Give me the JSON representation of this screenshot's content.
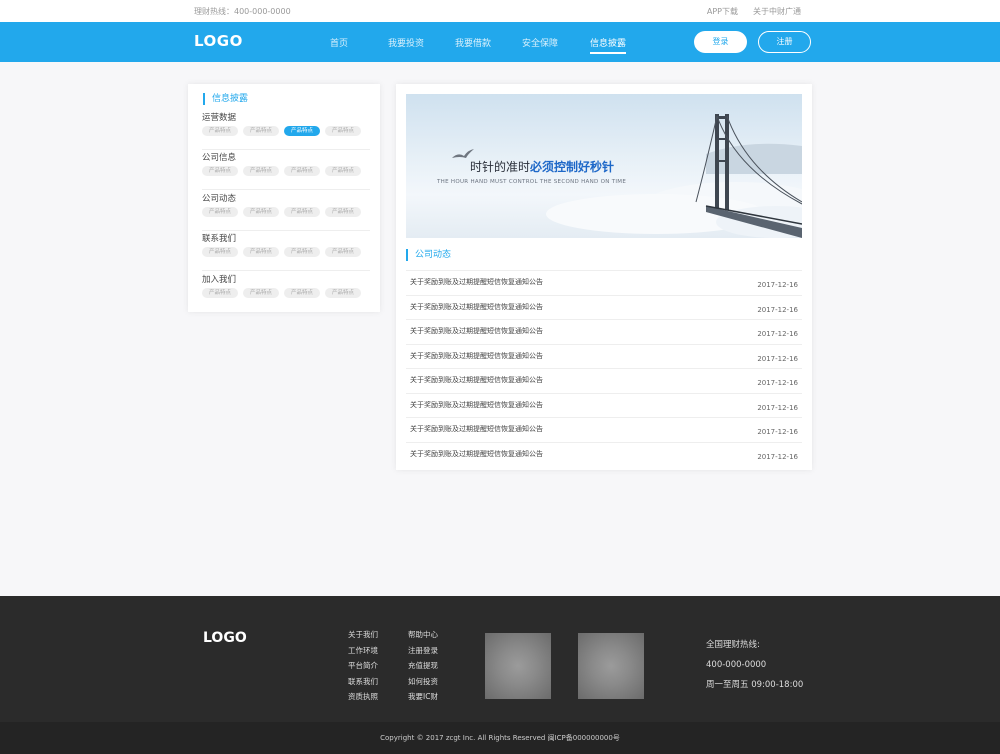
{
  "topbar": {
    "hotline": "理财热线：400-000-0000",
    "app_download": "APP下载",
    "about_broadcast": "关于中财广通"
  },
  "nav": {
    "logo": "LOGO",
    "items": [
      {
        "label": "首页"
      },
      {
        "label": "我要投资"
      },
      {
        "label": "我要借款"
      },
      {
        "label": "安全保障"
      },
      {
        "label": "信息披露"
      }
    ],
    "active": "信息披露",
    "login": "登录",
    "register": "注册",
    "accent_color": "#22a8ec"
  },
  "sidebar": {
    "title": "信息披露",
    "groups": [
      {
        "title": "运营数据",
        "tags": [
          "产品特点",
          "产品特点",
          "产品特点",
          "产品特点"
        ],
        "active_tag": 2
      },
      {
        "title": "公司信息",
        "tags": [
          "产品特点",
          "产品特点",
          "产品特点",
          "产品特点"
        ]
      },
      {
        "title": "公司动态",
        "tags": [
          "产品特点",
          "产品特点",
          "产品特点",
          "产品特点"
        ]
      },
      {
        "title": "联系我们",
        "tags": [
          "产品特点",
          "产品特点",
          "产品特点",
          "产品特点"
        ]
      },
      {
        "title": "加入我们",
        "tags": [
          "产品特点",
          "产品特点",
          "产品特点",
          "产品特点"
        ]
      }
    ]
  },
  "banner": {
    "slogan_plain": "时针的准时",
    "slogan_highlight": "必须控制好秒针",
    "subtitle": "THE HOUR HAND MUST CONTROL THE SECOND HAND ON TIME"
  },
  "news": {
    "title": "公司动态",
    "items": [
      {
        "title": "关于奖励到账及过期提醒短信恢复通知公告",
        "date": "2017-12-16"
      },
      {
        "title": "关于奖励到账及过期提醒短信恢复通知公告",
        "date": "2017-12-16"
      },
      {
        "title": "关于奖励到账及过期提醒短信恢复通知公告",
        "date": "2017-12-16"
      },
      {
        "title": "关于奖励到账及过期提醒短信恢复通知公告",
        "date": "2017-12-16"
      },
      {
        "title": "关于奖励到账及过期提醒短信恢复通知公告",
        "date": "2017-12-16"
      },
      {
        "title": "关于奖励到账及过期提醒短信恢复通知公告",
        "date": "2017-12-16"
      },
      {
        "title": "关于奖励到账及过期提醒短信恢复通知公告",
        "date": "2017-12-16"
      },
      {
        "title": "关于奖励到账及过期提醒短信恢复通知公告",
        "date": "2017-12-16"
      }
    ]
  },
  "footer": {
    "logo": "LOGO",
    "col1": [
      "关于我们",
      "工作环境",
      "平台简介",
      "联系我们",
      "资质执照"
    ],
    "col2": [
      "帮助中心",
      "注册登录",
      "充值提现",
      "如何投资",
      "我要IC财"
    ],
    "hotline_label": "全国理财热线:",
    "hotline": "400-000-0000",
    "hours": "周一至周五 09:00-18:00",
    "copyright": "Copyright © 2017 zcgt Inc. All Rights Reserved 闽ICP备000000000号"
  }
}
